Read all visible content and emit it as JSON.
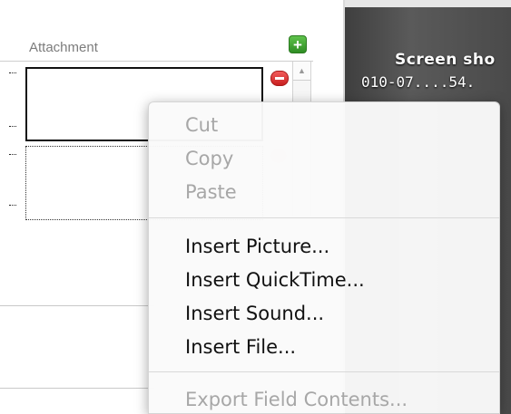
{
  "attachment_panel": {
    "label": "Attachment",
    "add_symbol": "+"
  },
  "background_preview": {
    "title": "Screen sho",
    "subtitle": "010-07....54."
  },
  "context_menu": {
    "items": [
      {
        "label": "Cut",
        "enabled": false
      },
      {
        "label": "Copy",
        "enabled": false
      },
      {
        "label": "Paste",
        "enabled": false
      },
      {
        "label": "Insert Picture...",
        "enabled": true
      },
      {
        "label": "Insert QuickTime...",
        "enabled": true
      },
      {
        "label": "Insert Sound...",
        "enabled": true
      },
      {
        "label": "Insert File...",
        "enabled": true
      },
      {
        "label": "Export Field Contents...",
        "enabled": false
      }
    ]
  },
  "colors": {
    "add_button": "#3fa32f",
    "remove_button": "#d92b2b",
    "disabled_text": "#a7a7a7",
    "enabled_text": "#111111"
  }
}
